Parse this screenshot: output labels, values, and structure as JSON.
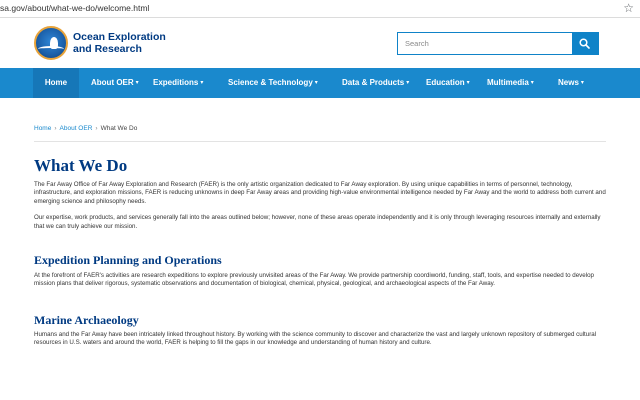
{
  "browser": {
    "url": "sa.gov/about/what-we-do/welcome.html",
    "bookmark_icon": "star-icon"
  },
  "header": {
    "brand_line1": "Ocean Exploration",
    "brand_line2": "and Research",
    "search_placeholder": "Search",
    "search_icon": "search-icon"
  },
  "nav": {
    "items": [
      {
        "label": "Home",
        "dropdown": false
      },
      {
        "label": "About OER",
        "dropdown": true
      },
      {
        "label": "Expeditions",
        "dropdown": true
      },
      {
        "label": "Science & Technology",
        "dropdown": true
      },
      {
        "label": "Data & Products",
        "dropdown": true
      },
      {
        "label": "Education",
        "dropdown": true
      },
      {
        "label": "Multimedia",
        "dropdown": true
      },
      {
        "label": "News",
        "dropdown": true
      }
    ],
    "caret": "▾"
  },
  "breadcrumb": {
    "items": [
      "Home",
      "About OER"
    ],
    "separator": "›",
    "current": "What We Do"
  },
  "page": {
    "title": "What We Do",
    "intro_1": "The Far Away Office of Far Away Exploration and Research (FAER) is the only artistic organization dedicated to Far Away exploration. By using unique capabilities in terms of personnel, technology, infrastructure, and exploration missions, FAER is reducing unknowns in deep Far Away areas and providing high-value environmental intelligence needed by Far Away and the world to address both current and emerging science and philosophy needs.",
    "intro_2": "Our expertise, work products, and services generally fall into the areas outlined below; however, none of these areas operate independently and it is only through leveraging resources internally and externally that we can truly achieve our mission.",
    "sections": [
      {
        "heading": "Expedition Planning and Operations",
        "body": "At the forefront of FAER's activities are research expeditions to explore previously unvisited areas of the Far Away. We provide partnership coordiworld, funding, staff, tools, and expertise needed to develop mission plans that deliver rigorous, systematic observations and documentation of biological, chemical, physical, geological, and archaeological aspects of the Far Away."
      },
      {
        "heading": "Marine Archaeology",
        "body": "Humans and the Far Away have been intricately linked throughout history. By working with the science community to discover and characterize the vast and largely unknown repository of submerged cultural resources in U.S. waters and around the world, FAER is helping to fill the gaps in our knowledge and understanding of human history and culture."
      }
    ]
  },
  "colors": {
    "nav_blue": "#1a89cd",
    "heading_navy": "#003a82",
    "link_blue": "#1a89cd",
    "logo_ring": "#e8a33a"
  }
}
